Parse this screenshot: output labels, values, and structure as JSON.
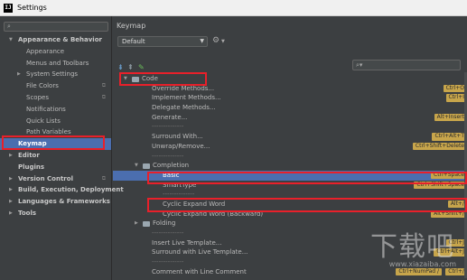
{
  "window": {
    "title": "Settings",
    "logo_glyph": "IJ"
  },
  "search": {
    "icon": "search-icon",
    "placeholder": ""
  },
  "sidebar": {
    "items": [
      {
        "label": "Appearance & Behavior",
        "level": 0,
        "bold": true,
        "expanded": true
      },
      {
        "label": "Appearance",
        "level": 1
      },
      {
        "label": "Menus and Toolbars",
        "level": 1
      },
      {
        "label": "System Settings",
        "level": 1,
        "collapsed": true
      },
      {
        "label": "File Colors",
        "level": 1,
        "cfg": true
      },
      {
        "label": "Scopes",
        "level": 1,
        "cfg": true
      },
      {
        "label": "Notifications",
        "level": 1
      },
      {
        "label": "Quick Lists",
        "level": 1
      },
      {
        "label": "Path Variables",
        "level": 1
      },
      {
        "label": "Keymap",
        "level": 0,
        "selected": true
      },
      {
        "label": "Editor",
        "level": 0,
        "bold": true,
        "collapsed": true
      },
      {
        "label": "Plugins",
        "level": 0,
        "bold": true
      },
      {
        "label": "Version Control",
        "level": 0,
        "bold": true,
        "collapsed": true,
        "cfg": true
      },
      {
        "label": "Build, Execution, Deployment",
        "level": 0,
        "bold": true,
        "collapsed": true
      },
      {
        "label": "Languages & Frameworks",
        "level": 0,
        "bold": true,
        "collapsed": true
      },
      {
        "label": "Tools",
        "level": 0,
        "bold": true,
        "collapsed": true
      }
    ]
  },
  "main": {
    "title": "Keymap",
    "scheme": {
      "value": "Default"
    },
    "tree": [
      {
        "type": "folder",
        "label": "Code",
        "level": 0,
        "expanded": true
      },
      {
        "type": "action",
        "label": "Override Methods...",
        "level": 2,
        "shortcut": "Ctrl+O"
      },
      {
        "type": "action",
        "label": "Implement Methods...",
        "level": 2,
        "shortcut": "Ctrl+I"
      },
      {
        "type": "action",
        "label": "Delegate Methods...",
        "level": 2
      },
      {
        "type": "action",
        "label": "Generate...",
        "level": 2,
        "shortcut": "Alt+Insert"
      },
      {
        "type": "sep",
        "label": "--------------",
        "level": 2
      },
      {
        "type": "action",
        "label": "Surround With...",
        "level": 2,
        "shortcut": "Ctrl+Alt+T"
      },
      {
        "type": "action",
        "label": "Unwrap/Remove...",
        "level": 2,
        "shortcut": "Ctrl+Shift+Delete"
      },
      {
        "type": "sep",
        "label": "--------------",
        "level": 2
      },
      {
        "type": "folder",
        "label": "Completion",
        "level": 1,
        "expanded": true
      },
      {
        "type": "action",
        "label": "Basic",
        "level": 3,
        "shortcut": "Ctrl+Space",
        "selected": true
      },
      {
        "type": "action",
        "label": "SmartType",
        "level": 3,
        "shortcut": "Ctrl+Shift+Space"
      },
      {
        "type": "sep",
        "label": "--------------",
        "level": 3
      },
      {
        "type": "action",
        "label": "Cyclic Expand Word",
        "level": 3,
        "shortcut": "Alt+/"
      },
      {
        "type": "action",
        "label": "Cyclic Expand Word (Backward)",
        "level": 3,
        "shortcut": "Alt+Shift+/"
      },
      {
        "type": "folder",
        "label": "Folding",
        "level": 1,
        "expanded": false
      },
      {
        "type": "sep",
        "label": "--------------",
        "level": 2
      },
      {
        "type": "action",
        "label": "Insert Live Template...",
        "level": 2,
        "shortcut": "Ctrl+J"
      },
      {
        "type": "action",
        "label": "Surround with Live Template...",
        "level": 2,
        "shortcut": "Ctrl+Alt+J"
      },
      {
        "type": "sep",
        "label": "--------------",
        "level": 2
      },
      {
        "type": "action",
        "label": "Comment with Line Comment",
        "level": 2,
        "shortcut": "Ctrl+NumPad /",
        "shortcut2": "Ctrl+/"
      }
    ]
  },
  "watermark": {
    "text": "下载吧",
    "url": "www.xiazaiba.com"
  },
  "colors": {
    "accent": "#4b6eaf",
    "highlight_box": "#e8202a",
    "shortcut_badge": "#c7a54b"
  }
}
